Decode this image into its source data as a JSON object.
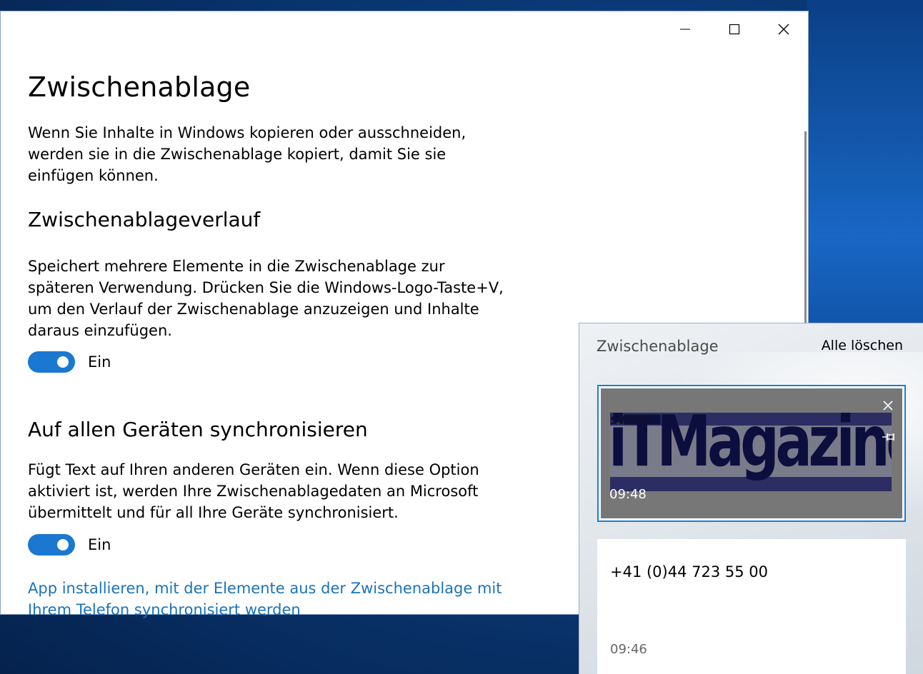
{
  "window": {
    "minimize_label": "Minimieren",
    "maximize_label": "Maximieren",
    "close_label": "Schließen"
  },
  "page": {
    "title": "Zwischenablage",
    "intro": "Wenn Sie Inhalte in Windows kopieren oder ausschneiden, werden sie in die Zwischenablage kopiert, damit Sie sie einfügen können."
  },
  "history": {
    "title": "Zwischenablageverlauf",
    "description": "Speichert mehrere Elemente in die Zwischenablage zur späteren Verwendung. Drücken Sie die Windows-Logo-Taste+V, um den Verlauf der Zwischenablage anzuzeigen und Inhalte daraus einzufügen.",
    "toggle_state": "Ein"
  },
  "sync": {
    "title": "Auf allen Geräten synchronisieren",
    "description": "Fügt Text auf Ihren anderen Geräten ein. Wenn diese Option aktiviert ist, werden Ihre Zwischenablagedaten an Microsoft übermittelt und für all Ihre Geräte synchronisiert.",
    "toggle_state": "Ein"
  },
  "link": {
    "text": "App installieren, mit der Elemente aus der Zwischenablage mit Ihrem Telefon synchronisiert werden"
  },
  "clipboard_panel": {
    "title": "Zwischenablage",
    "clear_all": "Alle löschen",
    "items": [
      {
        "type": "image",
        "logo_small": "SWISS",
        "logo_main": "iTMagazine",
        "time": "09:48"
      },
      {
        "type": "text",
        "text": "+41 (0)44 723 55 00",
        "time": "09:46"
      }
    ]
  },
  "colors": {
    "accent": "#1a78d0",
    "link": "#1a73b9",
    "selection_border": "#1a7fd6"
  },
  "icons": {
    "minimize": "minimize-icon",
    "maximize": "maximize-icon",
    "close": "close-icon",
    "pin": "pin-icon"
  }
}
